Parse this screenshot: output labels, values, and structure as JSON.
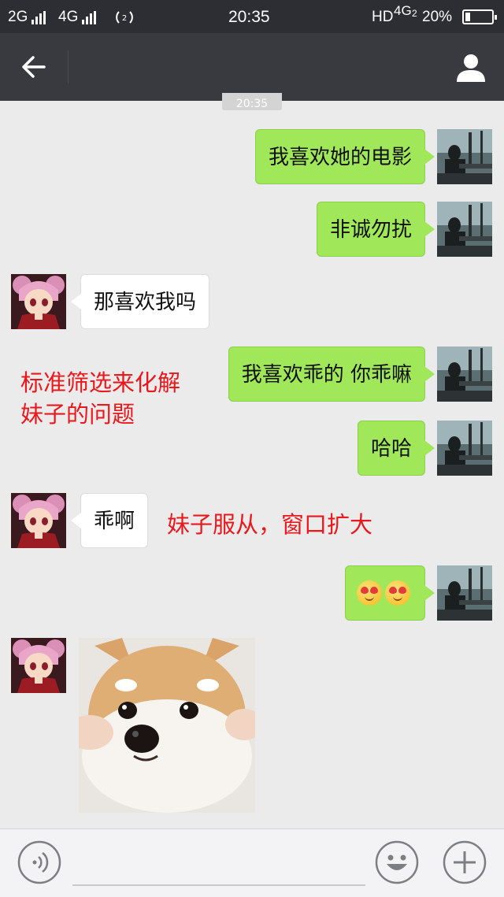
{
  "status_bar": {
    "network1": "2G",
    "network2": "4G",
    "time": "20:35",
    "hd": "HD",
    "network3": "4G",
    "network3_sub": "2",
    "battery": "20%",
    "battery_level": 0.2
  },
  "header": {
    "back_icon": "back-arrow-icon",
    "title": "",
    "profile_icon": "person-icon"
  },
  "timestamp": "20:35",
  "messages": [
    {
      "side": "me",
      "text": "我喜欢她的电影"
    },
    {
      "side": "me",
      "text": "非诚勿扰"
    },
    {
      "side": "other",
      "text": "那喜欢我吗"
    },
    {
      "side": "me",
      "text": "我喜欢乖的 你乖嘛"
    },
    {
      "side": "me",
      "text": "哈哈"
    },
    {
      "side": "other",
      "text": "乖啊"
    },
    {
      "side": "me",
      "emoji": [
        "heart-eyes-emoji",
        "heart-eyes-emoji"
      ]
    },
    {
      "side": "other",
      "sticker": "shiba-dog-sticker"
    }
  ],
  "annotations": {
    "note1_line1": "标准筛选来化解",
    "note1_line2": "妹子的问题",
    "note2": "妹子服从，窗口扩大"
  },
  "input_bar": {
    "voice_icon": "voice-icon",
    "emoji_icon": "smiley-icon",
    "plus_icon": "plus-icon"
  },
  "colors": {
    "my_bubble": "#a0e75a",
    "other_bubble": "#ffffff",
    "annotation": "#e8181d",
    "header": "#393a3f",
    "background": "#ebebeb"
  }
}
